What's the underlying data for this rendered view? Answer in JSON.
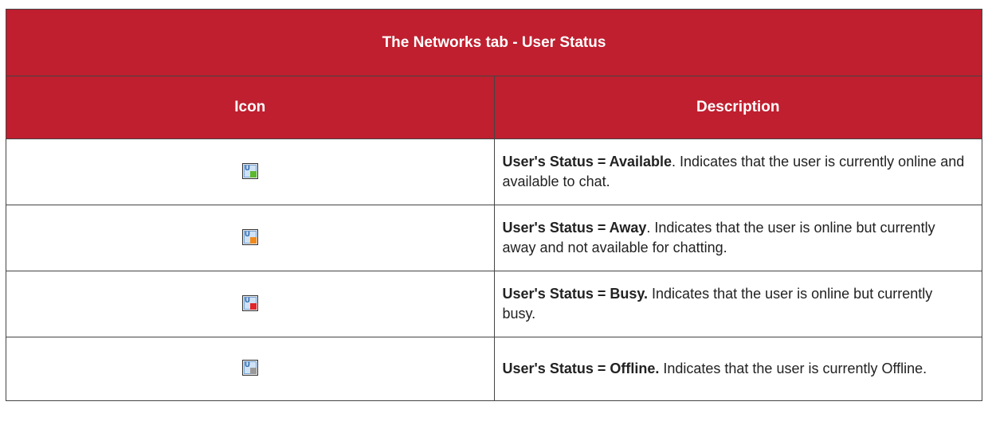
{
  "table": {
    "title": "The Networks tab - User Status",
    "headers": {
      "icon": "Icon",
      "description": "Description"
    },
    "rows": [
      {
        "icon": "user-available-icon",
        "status_color": "#5cb82e",
        "status_label": "User's Status = Available",
        "description": ". Indicates that the user is currently online and available to chat."
      },
      {
        "icon": "user-away-icon",
        "status_color": "#f08a1c",
        "status_label": "User's Status = Away",
        "description": ". Indicates that the user is online but currently away and not available for chatting."
      },
      {
        "icon": "user-busy-icon",
        "status_color": "#e0262a",
        "status_label": "User's Status = Busy.",
        "description": " Indicates that the user is online but currently busy."
      },
      {
        "icon": "user-offline-icon",
        "status_color": "#9a9a9a",
        "status_label": "User's Status = Offline.",
        "description": " Indicates that the user is currently Offline."
      }
    ]
  }
}
